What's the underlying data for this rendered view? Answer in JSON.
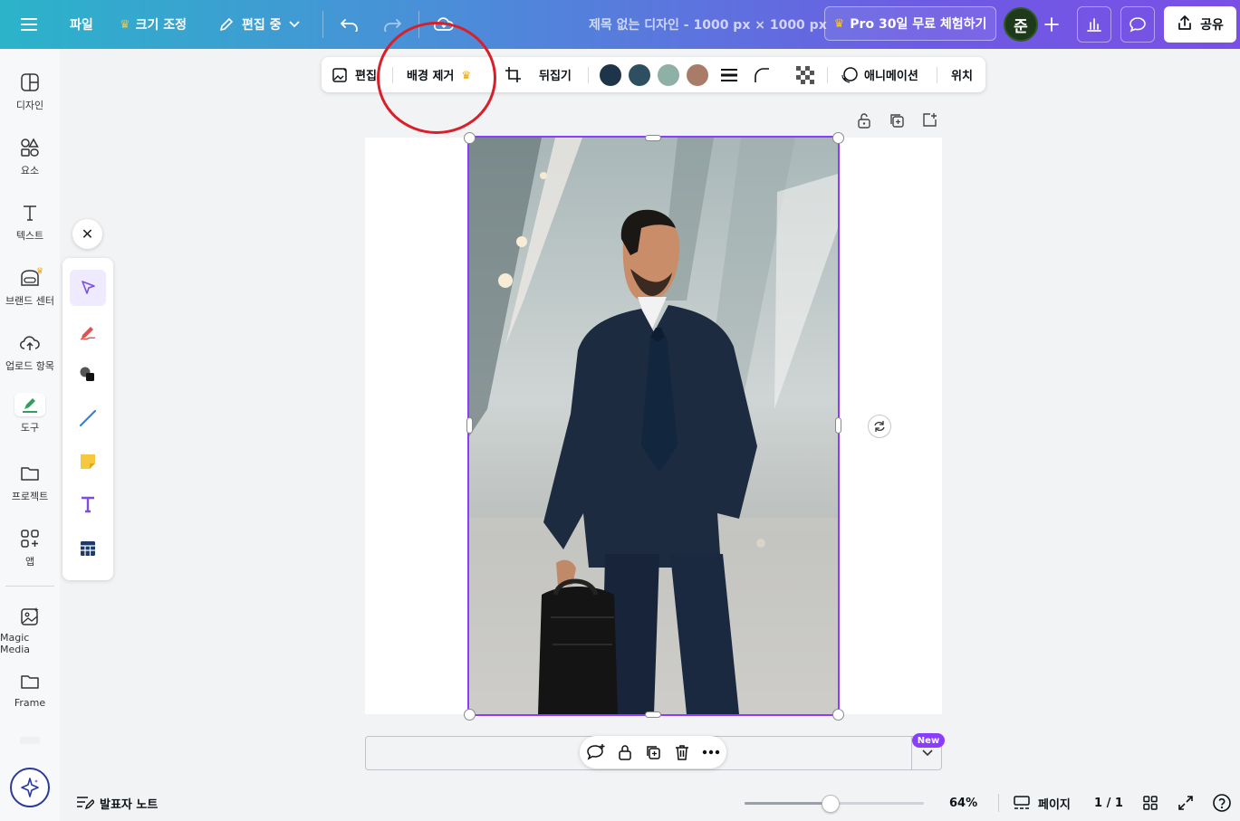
{
  "topbar": {
    "file_label": "파일",
    "resize_label": "크기 조정",
    "edit_mode_label": "편집 중",
    "doc_title": "제목 없는 디자인 - 1000 px × 1000 px",
    "pro_trial_label": "Pro 30일 무료 체험하기",
    "avatar_initial": "준",
    "share_label": "공유"
  },
  "sidebar": {
    "items": [
      {
        "label": "디자인",
        "icon": "design-icon"
      },
      {
        "label": "요소",
        "icon": "elements-icon"
      },
      {
        "label": "텍스트",
        "icon": "text-icon"
      },
      {
        "label": "브랜드 센터",
        "icon": "brand-icon"
      },
      {
        "label": "업로드 항목",
        "icon": "upload-icon"
      },
      {
        "label": "도구",
        "icon": "tools-icon"
      },
      {
        "label": "프로젝트",
        "icon": "folder-icon"
      },
      {
        "label": "앱",
        "icon": "apps-icon"
      },
      {
        "label": "Magic Media",
        "icon": "magic-media-icon"
      },
      {
        "label": "Frame",
        "icon": "frame-icon"
      }
    ]
  },
  "context_toolbar": {
    "edit_label": "편집",
    "remove_bg_label": "배경 제거",
    "flip_label": "뒤집기",
    "animate_label": "애니메이션",
    "position_label": "위치",
    "swatches": [
      "#1e3448",
      "#2d4f5f",
      "#8fb0a6",
      "#a97c69"
    ]
  },
  "notes": {
    "new_badge": "New"
  },
  "footer": {
    "notes_label": "발표자 노트",
    "zoom": "64%",
    "zoom_fraction": 0.48,
    "pages_label": "페이지",
    "page_count": "1 / 1"
  },
  "colors": {
    "accent": "#8b3dff",
    "annotation": "#d9202a"
  }
}
